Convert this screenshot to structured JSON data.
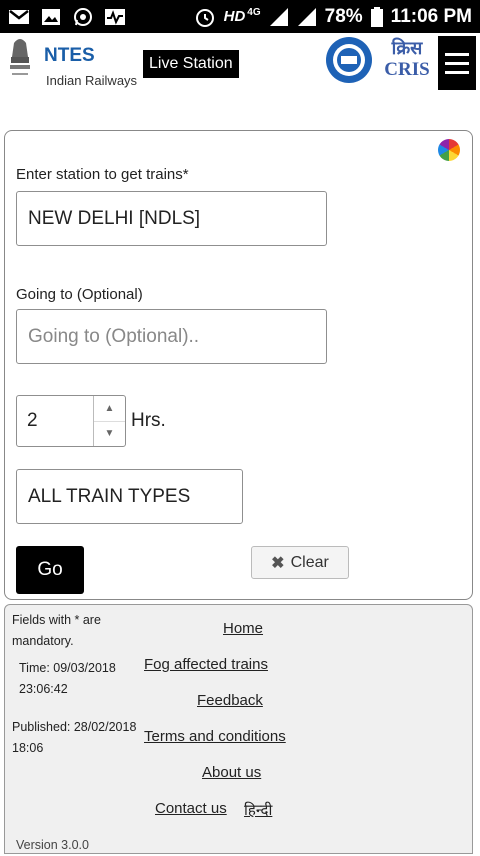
{
  "status_bar": {
    "network": "HD",
    "signal_label": "4G",
    "battery": "78%",
    "time": "11:06 PM",
    "left_icons": [
      "gmail-icon",
      "gallery-icon",
      "whatsapp-icon",
      "activity-icon"
    ]
  },
  "header": {
    "brand_title": "NTES",
    "brand_subtitle": "Indian Railways",
    "live_station_button": "Live Station",
    "logo_text": "CRIS",
    "logo_devanagari": "क्रिस"
  },
  "form": {
    "station_label": "Enter station to get trains*",
    "station_value": "NEW DELHI [NDLS]",
    "going_label": "Going to (Optional)",
    "going_placeholder": "Going to (Optional)..",
    "hours_value": "2",
    "hours_unit": "Hrs.",
    "train_type": "ALL TRAIN TYPES",
    "go_button": "Go",
    "clear_button": "Clear"
  },
  "footer": {
    "mandatory_note": "Fields with * are mandatory.",
    "time_label": "Time: 09/03/2018 23:06:42",
    "published_label": "Published: 28/02/2018 18:06",
    "links": {
      "home": "Home",
      "fog": "Fog affected trains",
      "feedback": "Feedback",
      "terms": "Terms and conditions",
      "about": "About us",
      "contact": "Contact us",
      "hindi": "हिन्दी"
    },
    "version": "Version 3.0.0"
  }
}
